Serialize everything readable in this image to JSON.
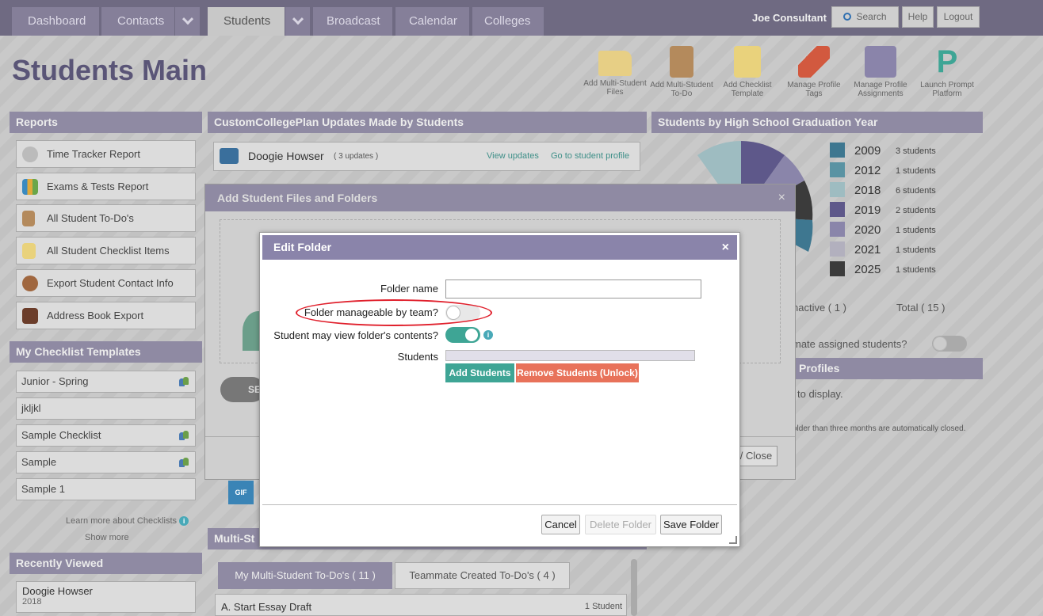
{
  "nav": {
    "tabs": [
      "Dashboard",
      "Contacts",
      "Students",
      "Broadcast",
      "Calendar",
      "Colleges"
    ],
    "user": "Joe Consultant",
    "search": "Search",
    "help": "Help",
    "logout": "Logout"
  },
  "page_title": "Students Main",
  "actions": [
    {
      "label": "Add Multi-Student Files",
      "icon": "folder-icon"
    },
    {
      "label": "Add Multi-Student To-Do",
      "icon": "clipboard-icon"
    },
    {
      "label": "Add Checklist Template",
      "icon": "notepad-icon"
    },
    {
      "label": "Manage Profile Tags",
      "icon": "pushpin-icon"
    },
    {
      "label": "Manage Profile Assignments",
      "icon": "paperclip-icon"
    },
    {
      "label": "Launch Prompt Platform",
      "icon": "prompt-logo-icon"
    }
  ],
  "reports": {
    "title": "Reports",
    "items": [
      "Time Tracker Report",
      "Exams & Tests Report",
      "All Student To-Do's",
      "All Student Checklist Items",
      "Export Student Contact Info",
      "Address Book Export"
    ]
  },
  "checklists": {
    "title": "My Checklist Templates",
    "items": [
      {
        "name": "Junior - Spring",
        "team": true
      },
      {
        "name": "jkljkl",
        "team": false
      },
      {
        "name": "Sample Checklist",
        "team": true
      },
      {
        "name": "Sample",
        "team": true
      },
      {
        "name": "Sample 1",
        "team": false
      }
    ],
    "learn_more": "Learn more about Checklists",
    "show_more": "Show more"
  },
  "recent": {
    "title": "Recently Viewed",
    "name": "Doogie Howser",
    "year": "2018"
  },
  "updates": {
    "title": "CustomCollegePlan Updates Made by Students",
    "student": "Doogie Howser",
    "count": "( 3 updates )",
    "view": "View updates",
    "goto": "Go to student profile"
  },
  "grad": {
    "title": "Students by High School Graduation Year",
    "legend": [
      {
        "year": "2009",
        "count": "3 students",
        "color": "#3e7790"
      },
      {
        "year": "2012",
        "count": "1 students",
        "color": "#5a93a3"
      },
      {
        "year": "2018",
        "count": "6 students",
        "color": "#9ebcc1"
      },
      {
        "year": "2019",
        "count": "2 students",
        "color": "#5e588a"
      },
      {
        "year": "2020",
        "count": "1 students",
        "color": "#8a85aa"
      },
      {
        "year": "2021",
        "count": "1 students",
        "color": "#b2b0be"
      },
      {
        "year": "2025",
        "count": "1 students",
        "color": "#3b3b3b"
      }
    ],
    "inactive": "nactive ( 1 )",
    "total": "Total ( 15 )",
    "teammate": "mate assigned students?"
  },
  "profiles": {
    "title": "Profiles",
    "display": "to display.",
    "note": "older than three months are automatically closed.",
    "close": "/ Close"
  },
  "multi": {
    "title": "Multi-St",
    "tab1": "My Multi-Student To-Do's ( 11 )",
    "tab2": "Teammate Created To-Do's ( 4 )",
    "row": "A. Start Essay Draft",
    "row_count": "1 Student"
  },
  "outer_modal": {
    "title": "Add Student Files and Folders",
    "close": "×",
    "btn": "SE",
    "gif": "GIF"
  },
  "modal": {
    "title": "Edit Folder",
    "close": "×",
    "folder_name_label": "Folder name",
    "folder_name_value": "",
    "manageable_label": "Folder manageable by team?",
    "manageable_on": false,
    "view_label": "Student may view folder's contents?",
    "view_on": true,
    "students_label": "Students",
    "add_students": "Add Students",
    "remove_students": "Remove Students (Unlock)",
    "cancel": "Cancel",
    "delete": "Delete Folder",
    "save": "Save Folder"
  },
  "colors": {
    "accent": "#8a84aa",
    "teal": "#3ea595",
    "red": "#e8725a"
  }
}
